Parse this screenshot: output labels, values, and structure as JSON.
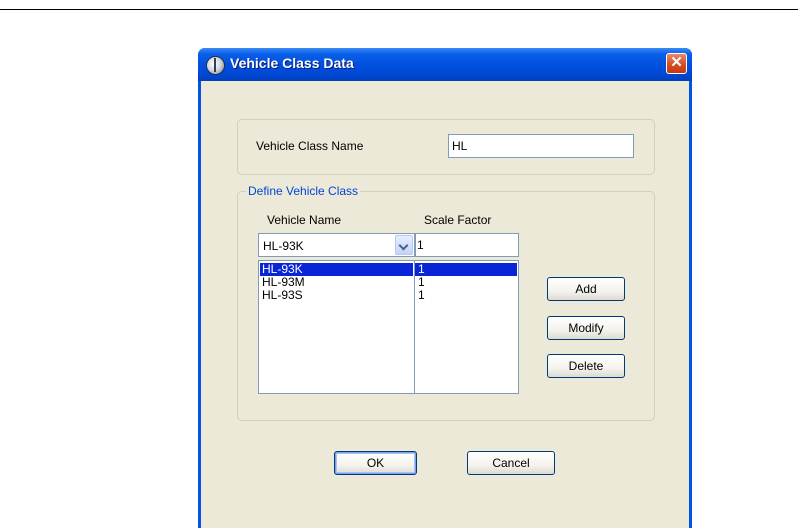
{
  "window": {
    "title": "Vehicle Class Data",
    "close_label": "✕"
  },
  "class_name": {
    "label": "Vehicle Class Name",
    "value": "HL"
  },
  "define": {
    "legend": "Define Vehicle Class",
    "col_vehicle_name": "Vehicle Name",
    "col_scale_factor": "Scale Factor",
    "combo_value": "HL-93K",
    "scale_value": "1",
    "rows": [
      {
        "name": "HL-93K",
        "scale": "1",
        "selected": true
      },
      {
        "name": "HL-93M",
        "scale": "1",
        "selected": false
      },
      {
        "name": "HL-93S",
        "scale": "1",
        "selected": false
      }
    ]
  },
  "buttons": {
    "add": "Add",
    "modify": "Modify",
    "delete": "Delete",
    "ok": "OK",
    "cancel": "Cancel"
  },
  "colors": {
    "title_bar": "#0054e3",
    "selection": "#0a24d8",
    "dialog_bg": "#ece9d8",
    "legend_text": "#0046d5"
  },
  "icons": {
    "title": "app-globe-icon",
    "close": "close-icon",
    "dropdown": "chevron-down-icon"
  }
}
